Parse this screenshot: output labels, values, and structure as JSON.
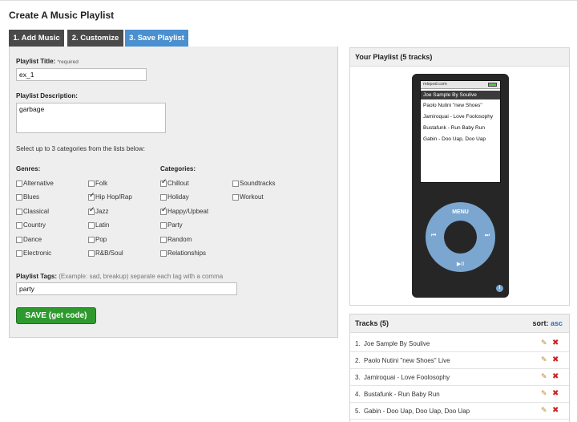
{
  "page": {
    "title": "Create A Music Playlist"
  },
  "tabs": [
    {
      "label": "1. Add Music"
    },
    {
      "label": "2. Customize"
    },
    {
      "label": "3. Save Playlist"
    }
  ],
  "form": {
    "title_label": "Playlist Title:",
    "required_mark": "*required",
    "title_value": "ex_1",
    "description_label": "Playlist Description:",
    "description_value": "garbage",
    "instructions": "Select up to 3 categories from the lists below:",
    "genres_label": "Genres:",
    "categories_label": "Categories:",
    "genres": [
      {
        "label": "Alternative",
        "checked": false
      },
      {
        "label": "Blues",
        "checked": false
      },
      {
        "label": "Classical",
        "checked": false
      },
      {
        "label": "Country",
        "checked": false
      },
      {
        "label": "Dance",
        "checked": false
      },
      {
        "label": "Electronic",
        "checked": false
      },
      {
        "label": "Folk",
        "checked": false
      },
      {
        "label": "Hip Hop/Rap",
        "checked": true
      },
      {
        "label": "Jazz",
        "checked": true
      },
      {
        "label": "Latin",
        "checked": false
      },
      {
        "label": "Pop",
        "checked": false
      },
      {
        "label": "R&B/Soul",
        "checked": false
      }
    ],
    "categories": [
      {
        "label": "Chillout",
        "checked": true
      },
      {
        "label": "Holiday",
        "checked": false
      },
      {
        "label": "Happy/Upbeat",
        "checked": true
      },
      {
        "label": "Party",
        "checked": false
      },
      {
        "label": "Random",
        "checked": false
      },
      {
        "label": "Relationships",
        "checked": false
      },
      {
        "label": "Soundtracks",
        "checked": false
      },
      {
        "label": "Workout",
        "checked": false
      }
    ],
    "tags_label": "Playlist Tags:",
    "tags_note": "(Example: sad, breakup) separate each tag with a comma",
    "tags_value": "party",
    "save_label": "SAVE (get code)"
  },
  "playlist": {
    "title": "Your Playlist (5 tracks)",
    "screen_brand": "mixpod.com",
    "screen_items": [
      "Joe Sample By Soulive",
      "Paolo Nutini \"new Shoes\"",
      "Jamiroquai - Love Foolosophy",
      "Bustafunk - Run Baby Run",
      "Gabin - Doo Uap, Doo Uap"
    ],
    "menu_label": "MENU",
    "prev_icon": "⏮",
    "next_icon": "⏭",
    "play_icon": "▶II",
    "info_icon": "i"
  },
  "tracks": {
    "title": "Tracks (5)",
    "sort_label": "sort:",
    "sort_value": "asc",
    "items": [
      {
        "num": "1.",
        "name": "Joe Sample By Soulive"
      },
      {
        "num": "2.",
        "name": "Paolo Nutini \"new Shoes\" Live"
      },
      {
        "num": "3.",
        "name": "Jamiroquai - Love Foolosophy"
      },
      {
        "num": "4.",
        "name": "Bustafunk - Run Baby Run"
      },
      {
        "num": "5.",
        "name": "Gabin - Doo Uap, Doo Uap, Doo Uap"
      }
    ],
    "edit_icon": "✎",
    "delete_icon": "✖"
  }
}
